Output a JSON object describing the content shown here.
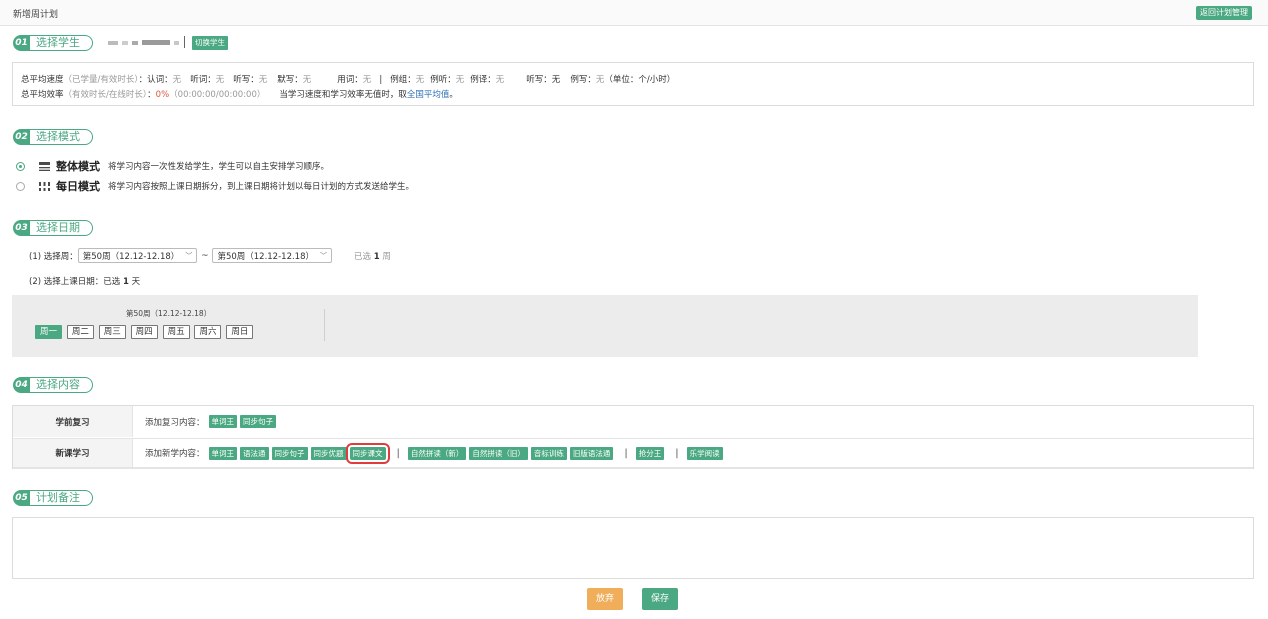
{
  "header": {
    "title": "新增周计划",
    "back_label": "返回计划管理"
  },
  "sections": {
    "s1": {
      "num": "01",
      "label": "选择学生"
    },
    "s2": {
      "num": "02",
      "label": "选择模式"
    },
    "s3": {
      "num": "03",
      "label": "选择日期"
    },
    "s4": {
      "num": "04",
      "label": "选择内容"
    },
    "s5": {
      "num": "05",
      "label": "计划备注"
    }
  },
  "student": {
    "switch_label": "切换学生"
  },
  "stats": {
    "line1": {
      "label": "总平均速度",
      "hint": "（已学量/有效时长）",
      "colon": "：",
      "items": [
        {
          "label": "认词：",
          "value": "无"
        },
        {
          "label": "听词：",
          "value": "无"
        },
        {
          "label": "听写：",
          "value": "无"
        },
        {
          "label": "默写：",
          "value": "无"
        },
        {
          "label": "用词：",
          "value": "无"
        },
        {
          "label": "例组：",
          "value": "无"
        },
        {
          "label": "例听：",
          "value": "无"
        },
        {
          "label": "例译：",
          "value": "无"
        },
        {
          "label": "听写：",
          "value": "无"
        },
        {
          "label": "例写：",
          "value": "无"
        }
      ],
      "separator": "|",
      "unit": "（单位：个/小时）"
    },
    "line2": {
      "label": "总平均效率",
      "hint": "（有效时长/在线时长）",
      "colon": "：",
      "value": "0%",
      "detail": "（00:00:00/00:00:00）",
      "note": "当学习速度和学习效率无值时，取",
      "link": "全国平均值",
      "tail": "。"
    }
  },
  "modes": [
    {
      "name": "整体模式",
      "desc": "将学习内容一次性发给学生，学生可以自主安排学习顺序。",
      "selected": true
    },
    {
      "name": "每日模式",
      "desc": "将学习内容按照上课日期拆分，到上课日期将计划以每日计划的方式发送给学生。",
      "selected": false
    }
  ],
  "date": {
    "week_label": "(1) 选择周：",
    "week_from": "第50周（12.12-12.18）",
    "tilde": "~",
    "week_to": "第50周（12.12-12.18）",
    "selected_weeks_prefix": "已选",
    "selected_weeks_count": "1",
    "selected_weeks_unit": "周",
    "day_label": "(2) 选择上课日期：已选",
    "selected_days_count": "1",
    "selected_days_unit": "天",
    "panel_week_title": "第50周（12.12-12.18）",
    "days": [
      {
        "label": "周一",
        "selected": true
      },
      {
        "label": "周二",
        "selected": false
      },
      {
        "label": "周三",
        "selected": false
      },
      {
        "label": "周四",
        "selected": false
      },
      {
        "label": "周五",
        "selected": false
      },
      {
        "label": "周六",
        "selected": false
      },
      {
        "label": "周日",
        "selected": false
      }
    ]
  },
  "content": {
    "review": {
      "head": "学前复习",
      "prefix": "添加复习内容：",
      "tags": [
        "单词王",
        "同步句子"
      ]
    },
    "new": {
      "head": "新课学习",
      "prefix": "添加新学内容：",
      "group1": [
        "单词王",
        "语法通",
        "同步句子",
        "同步优题",
        "同步课文"
      ],
      "group2": [
        "自然拼读（新）",
        "自然拼读（旧）",
        "音标训练",
        "旧版语法通"
      ],
      "group3": [
        "抢分王"
      ],
      "group4": [
        "乐学阅读"
      ],
      "separator": "|",
      "highlighted": "同步课文"
    }
  },
  "actions": {
    "discard": "放弃",
    "save": "保存"
  },
  "colors": {
    "accent": "#4aa882",
    "discard": "#f0ad5a",
    "highlight": "#e03c3c",
    "value_red": "#e2543c",
    "link_blue": "#2e6fb7"
  }
}
